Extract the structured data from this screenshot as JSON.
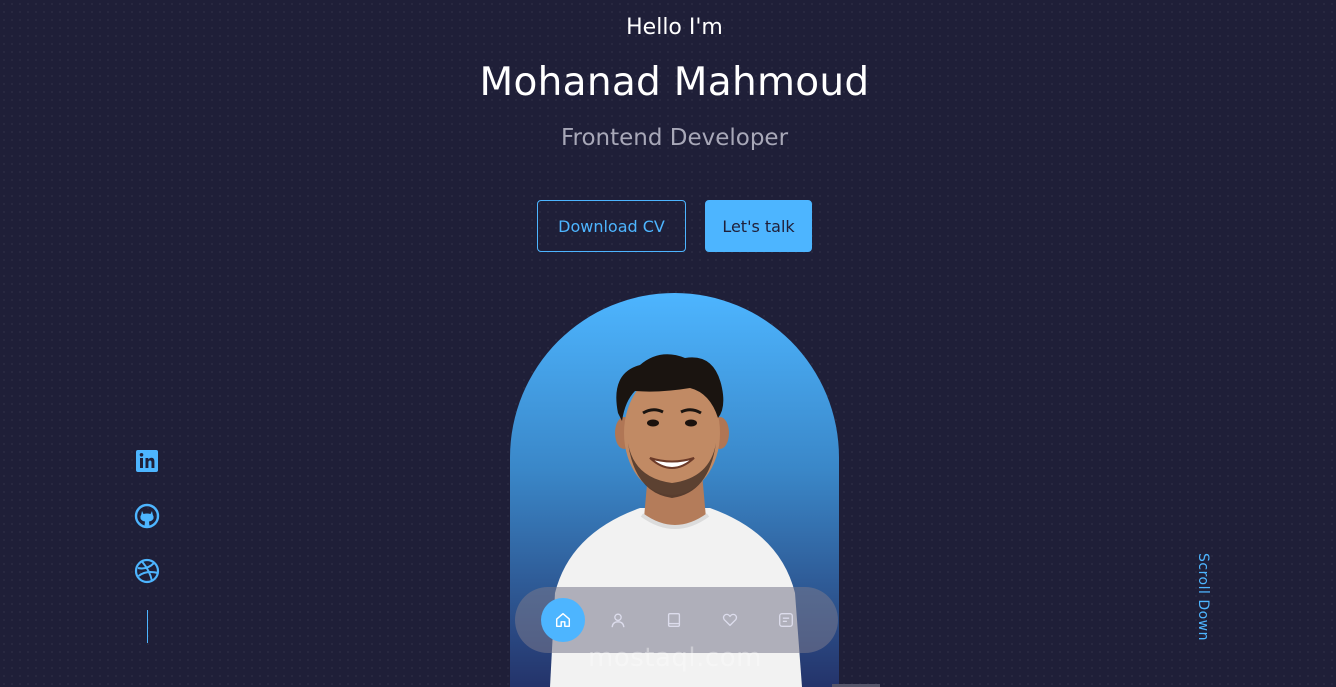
{
  "header": {
    "greeting": "Hello I'm",
    "name": "Mohanad Mahmoud",
    "role": "Frontend Developer"
  },
  "cta": {
    "download_label": "Download CV",
    "talk_label": "Let's talk"
  },
  "socials": [
    {
      "icon": "linkedin-icon"
    },
    {
      "icon": "github-icon"
    },
    {
      "icon": "dribbble-icon"
    }
  ],
  "scroll_label": "Scroll Down",
  "nav": {
    "items": [
      {
        "icon": "home-icon",
        "active": true
      },
      {
        "icon": "user-icon",
        "active": false
      },
      {
        "icon": "book-icon",
        "active": false
      },
      {
        "icon": "services-icon",
        "active": false
      },
      {
        "icon": "message-icon",
        "active": false
      }
    ]
  },
  "watermark": "mostaql.com",
  "colors": {
    "background": "#1f1f38",
    "accent": "#4db5ff",
    "muted": "#a8a8b8"
  }
}
